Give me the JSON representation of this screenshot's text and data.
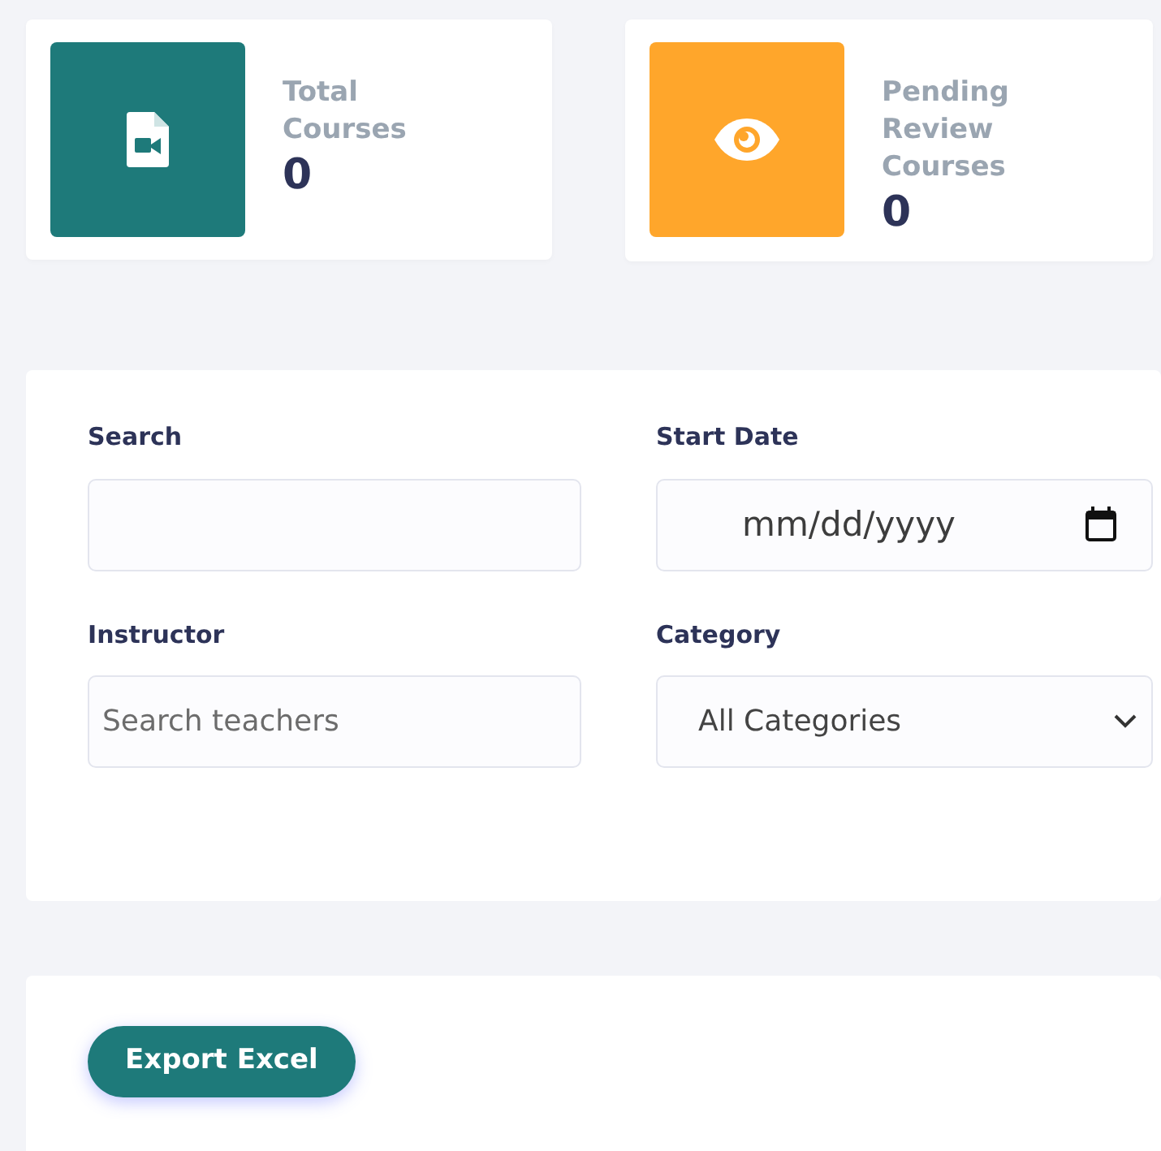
{
  "stats": [
    {
      "kind": "video-file",
      "color": "#1e7a7a",
      "title": "Total Courses",
      "value": "0"
    },
    {
      "kind": "eye",
      "color": "#ffa62b",
      "title": "Pending Review Courses",
      "value": "0"
    }
  ],
  "filters": [
    {
      "kind": "text",
      "label": "Search"
    },
    {
      "kind": "date",
      "label": "Start Date",
      "placeholder": "mm/dd/yyyy"
    },
    {
      "kind": "text",
      "label": "Instructor",
      "placeholder": "Search teachers"
    },
    {
      "kind": "select",
      "label": "Category",
      "value": "All Categories"
    }
  ],
  "export_button": "Export Excel"
}
